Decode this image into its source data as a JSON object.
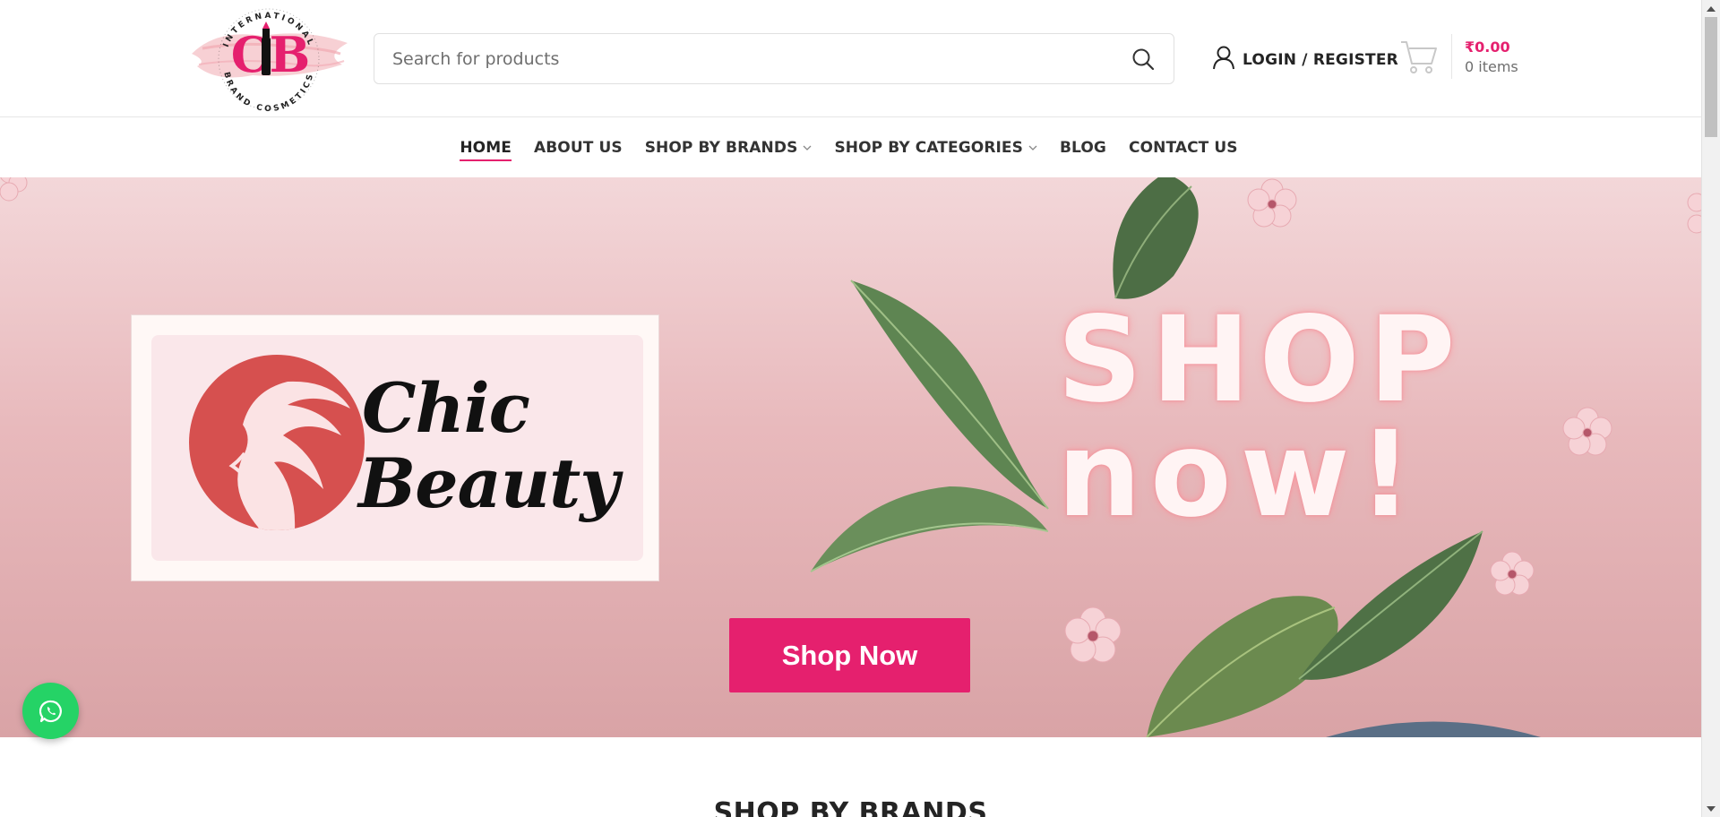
{
  "header": {
    "logo": {
      "top_text": "INTERNATIONAL",
      "bottom_text": "BRAND COSMETICS",
      "monogram": "CB"
    },
    "search": {
      "placeholder": "Search for products"
    },
    "login_label": "LOGIN / REGISTER",
    "cart": {
      "total": "₹0.00",
      "items": "0 items"
    }
  },
  "nav": {
    "items": [
      {
        "label": "HOME",
        "active": true,
        "dropdown": false
      },
      {
        "label": "ABOUT US",
        "active": false,
        "dropdown": false
      },
      {
        "label": "SHOP BY BRANDS",
        "active": false,
        "dropdown": true
      },
      {
        "label": "SHOP BY CATEGORIES",
        "active": false,
        "dropdown": true
      },
      {
        "label": "BLOG",
        "active": false,
        "dropdown": false
      },
      {
        "label": "CONTACT US",
        "active": false,
        "dropdown": false
      }
    ]
  },
  "hero": {
    "brand_line1": "Chic",
    "brand_line2": "Beauty",
    "headline_line1": "SHOP",
    "headline_line2": "now!",
    "button_label": "Shop Now"
  },
  "section": {
    "heading": "SHOP BY BRANDS"
  },
  "colors": {
    "accent": "#e5206e",
    "whatsapp": "#25d366",
    "brand_circle": "#d6504f"
  },
  "icons": {
    "search": "search-icon",
    "user": "user-icon",
    "cart": "cart-icon",
    "chevron": "chevron-down-icon",
    "whatsapp": "whatsapp-icon"
  }
}
